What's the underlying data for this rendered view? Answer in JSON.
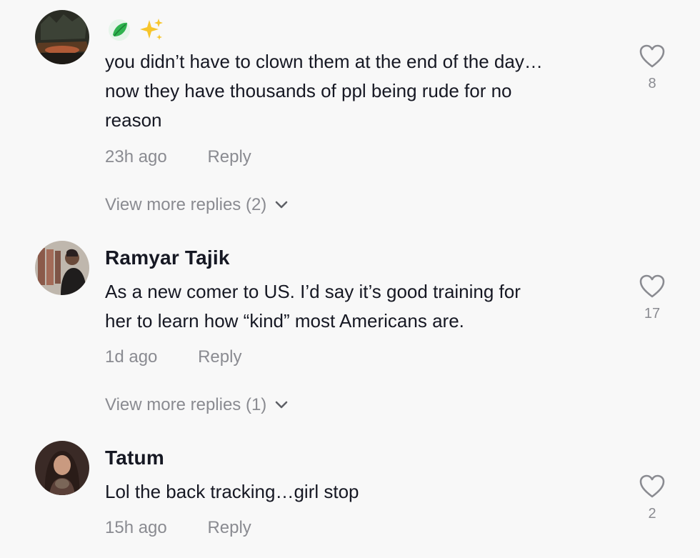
{
  "comments": [
    {
      "author_emojis": [
        "leaf-icon",
        "sparkles-icon"
      ],
      "text": "you didn’t have to clown them at the end of the day… \nnow they have thousands of ppl being rude for no \nreason",
      "time": "23h ago",
      "reply_label": "Reply",
      "likes": "8",
      "view_more": "View more replies (2)"
    },
    {
      "author": "Ramyar Tajik",
      "text": "As a new comer to US. I’d say it’s good training for \nher to learn how “kind” most Americans are.",
      "time": "1d ago",
      "reply_label": "Reply",
      "likes": "17",
      "view_more": "View more replies (1)"
    },
    {
      "author": "Tatum",
      "text": "Lol the back tracking…girl stop",
      "time": "15h ago",
      "reply_label": "Reply",
      "likes": "2"
    }
  ],
  "colors": {
    "background": "#f8f8f8",
    "text": "#161823",
    "secondary": "#8a8b91"
  }
}
